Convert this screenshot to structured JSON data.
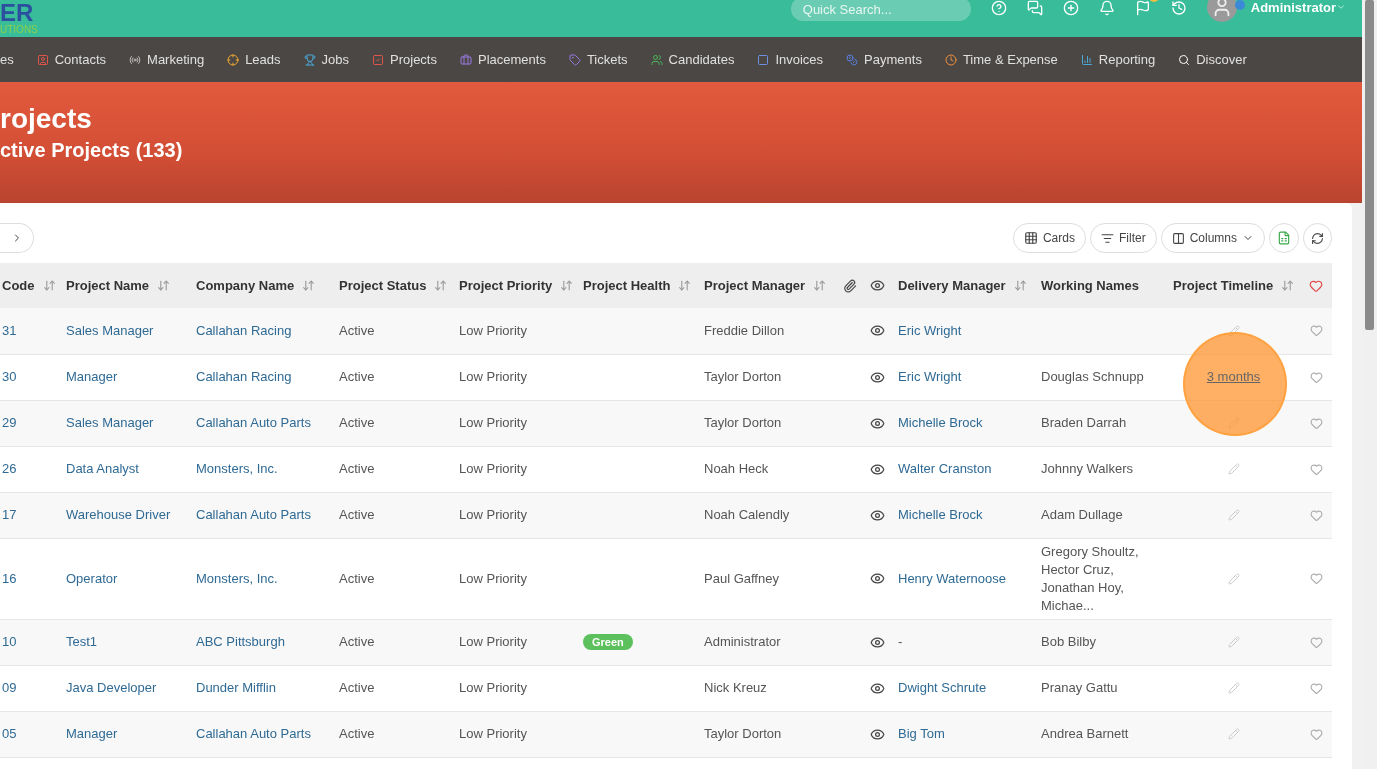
{
  "logo": {
    "main": "ER",
    "sub": "UTIONS"
  },
  "top_bar": {
    "search": {
      "placeholder": "Quick Search..."
    },
    "user": "Administrator"
  },
  "nav": [
    {
      "label": "es"
    },
    {
      "label": "Contacts"
    },
    {
      "label": "Marketing"
    },
    {
      "label": "Leads"
    },
    {
      "label": "Jobs"
    },
    {
      "label": "Projects"
    },
    {
      "label": "Placements"
    },
    {
      "label": "Tickets"
    },
    {
      "label": "Candidates"
    },
    {
      "label": "Invoices"
    },
    {
      "label": "Payments"
    },
    {
      "label": "Time & Expense"
    },
    {
      "label": "Reporting"
    },
    {
      "label": "Discover"
    }
  ],
  "hero": {
    "title": "rojects",
    "subtitle": "ctive Projects (133)"
  },
  "toolbar": {
    "buttons": [
      {
        "kind": "cards",
        "label": "Cards"
      },
      {
        "kind": "filter",
        "label": "Filter"
      },
      {
        "kind": "columns",
        "label": "Columns"
      },
      {
        "kind": "excel"
      },
      {
        "kind": "refresh"
      }
    ]
  },
  "table": {
    "columns": [
      {
        "kind": "sortable",
        "label": "Code"
      },
      {
        "kind": "sortable",
        "label": "Project Name"
      },
      {
        "kind": "sortable",
        "label": "Company Name"
      },
      {
        "kind": "sortable",
        "label": "Project Status"
      },
      {
        "kind": "sortable",
        "label": "Project Priority"
      },
      {
        "kind": "sortable",
        "label": "Project Health"
      },
      {
        "kind": "sortable",
        "label": "Project Manager"
      },
      {
        "kind": "attachment"
      },
      {
        "kind": "view"
      },
      {
        "kind": "sortable",
        "label": "Delivery Manager"
      },
      {
        "kind": "text",
        "label": "Working Names"
      },
      {
        "kind": "sortable",
        "label": "Project Timeline"
      },
      {
        "kind": "favorite"
      }
    ],
    "rows": [
      {
        "code": "31",
        "project_name": "Sales Manager",
        "company": "Callahan Racing",
        "status": "Active",
        "priority": "Low Priority",
        "manager": "Freddie Dillon",
        "delivery_manager": {
          "kind": "link",
          "text": "Eric Wright"
        },
        "timeline": {
          "kind": "edit"
        }
      },
      {
        "code": "30",
        "project_name": "Manager",
        "company": "Callahan Racing",
        "status": "Active",
        "priority": "Low Priority",
        "manager": "Taylor Dorton",
        "delivery_manager": {
          "kind": "link",
          "text": "Eric Wright"
        },
        "working_names": "Douglas Schnupp",
        "timeline": {
          "kind": "link",
          "text": "3 months"
        }
      },
      {
        "code": "29",
        "project_name": "Sales Manager",
        "company": "Callahan Auto Parts",
        "status": "Active",
        "priority": "Low Priority",
        "manager": "Taylor Dorton",
        "delivery_manager": {
          "kind": "link",
          "text": "Michelle Brock"
        },
        "working_names": "Braden Darrah",
        "timeline": {
          "kind": "edit"
        }
      },
      {
        "code": "26",
        "project_name": "Data Analyst",
        "company": "Monsters, Inc.",
        "status": "Active",
        "priority": "Low Priority",
        "manager": "Noah Heck",
        "delivery_manager": {
          "kind": "link",
          "text": "Walter Cranston"
        },
        "working_names": "Johnny Walkers",
        "timeline": {
          "kind": "edit"
        }
      },
      {
        "code": "17",
        "project_name": "Warehouse Driver",
        "company": "Callahan Auto Parts",
        "status": "Active",
        "priority": "Low Priority",
        "manager": "Noah Calendly",
        "delivery_manager": {
          "kind": "link",
          "text": "Michelle Brock"
        },
        "working_names": "Adam Dullage",
        "timeline": {
          "kind": "edit"
        }
      },
      {
        "code": "16",
        "project_name": "Operator",
        "company": "Monsters, Inc.",
        "status": "Active",
        "priority": "Low Priority",
        "manager": "Paul Gaffney",
        "delivery_manager": {
          "kind": "link",
          "text": "Henry Waternoose"
        },
        "working_names": "Gregory Shoultz,\nHector Cruz,\nJonathan Hoy,\nMichae...",
        "timeline": {
          "kind": "edit"
        }
      },
      {
        "code": "10",
        "project_name": "Test1",
        "company": "ABC Pittsburgh",
        "status": "Active",
        "priority": "Low Priority",
        "health": {
          "label": "Green",
          "color": "#5cc05c"
        },
        "manager": "Administrator",
        "delivery_manager": {
          "kind": "plain",
          "text": "-"
        },
        "working_names": "Bob Bilby",
        "timeline": {
          "kind": "edit"
        }
      },
      {
        "code": "09",
        "project_name": "Java Developer",
        "company": "Dunder Mifflin",
        "status": "Active",
        "priority": "Low Priority",
        "manager": "Nick Kreuz",
        "delivery_manager": {
          "kind": "link",
          "text": "Dwight Schrute"
        },
        "working_names": "Pranay Gattu",
        "timeline": {
          "kind": "edit"
        }
      },
      {
        "code": "05",
        "project_name": "Manager",
        "company": "Callahan Auto Parts",
        "status": "Active",
        "priority": "Low Priority",
        "manager": "Taylor Dorton",
        "delivery_manager": {
          "kind": "link",
          "text": "Big Tom"
        },
        "working_names": "Andrea Barnett",
        "timeline": {
          "kind": "edit"
        }
      }
    ]
  }
}
